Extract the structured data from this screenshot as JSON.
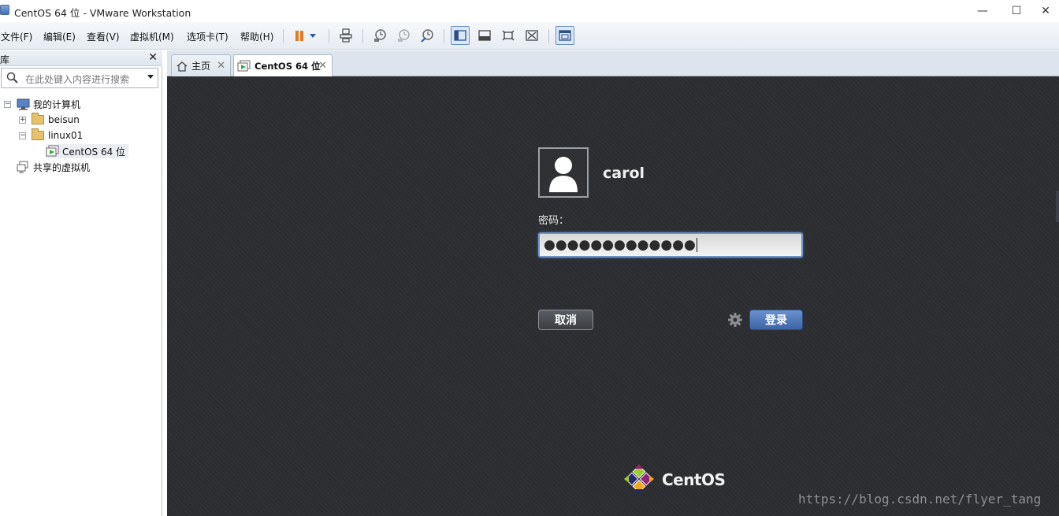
{
  "window": {
    "title": "CentOS 64 位 - VMware Workstation",
    "controls": [
      "—",
      "☐",
      "✕"
    ]
  },
  "menu": {
    "items": [
      "文件(F)",
      "编辑(E)",
      "查看(V)",
      "虚拟机(M)",
      "选项卡(T)",
      "帮助(H)"
    ]
  },
  "toolbar": {
    "icons": [
      "pause-icon",
      "dropdown-arrow-icon",
      "send-ctrl-alt-del-icon",
      "snapshot-take-icon",
      "snapshot-revert-icon",
      "snapshot-manager-icon",
      "library-view-icon",
      "thumbnail-bar-icon",
      "full-screen-icon",
      "unity-icon",
      "console-view-icon"
    ],
    "accent_pause": "#e07b1f"
  },
  "library": {
    "title": "库",
    "close": "✕",
    "search_placeholder": "在此处键入内容进行搜索",
    "tree": [
      {
        "label": "我的计算机",
        "expander": "−"
      },
      {
        "label": "beisun",
        "expander": "+"
      },
      {
        "label": "linux01",
        "expander": "−"
      },
      {
        "label": "CentOS 64 位"
      },
      {
        "label": "共享的虚拟机"
      }
    ]
  },
  "tabs": [
    {
      "label": "主页",
      "close": "✕"
    },
    {
      "label": "CentOS 64 位",
      "close": "✕"
    }
  ],
  "login": {
    "username": "carol",
    "password_label": "密码：",
    "password_value": "●●●●●●●●●●●●●",
    "cancel_label": "取消",
    "login_label": "登录",
    "background": "#2b2d30",
    "login_button_color": "#4a74b8"
  },
  "branding": {
    "wordmark": "CentOS",
    "watermark": "https://blog.csdn.net/flyer_tang"
  }
}
